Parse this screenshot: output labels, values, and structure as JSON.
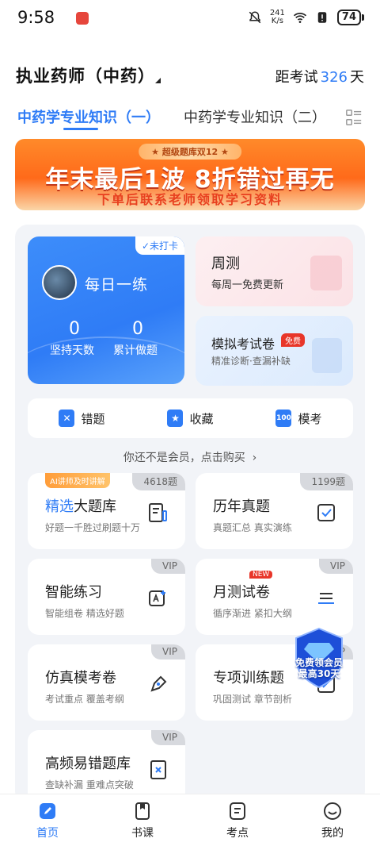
{
  "status_bar": {
    "time": "9:58",
    "net_speed_value": "241",
    "net_speed_unit": "K/s",
    "battery": "74"
  },
  "header": {
    "exam_title": "执业药师（中药）",
    "countdown_prefix": "距考试",
    "countdown_days": "326",
    "countdown_suffix": "天"
  },
  "tabs": [
    {
      "label": "中药学专业知识（一）",
      "active": true
    },
    {
      "label": "中药学专业知识（二）",
      "active": false
    }
  ],
  "banner": {
    "ribbon": "★ 超级题库双12 ★",
    "main": "年末最后1波 8折错过再无",
    "sub": "下单后联系老师领取学习资料"
  },
  "daily": {
    "checkin_tag": "✓未打卡",
    "title": "每日一练",
    "streak_value": "0",
    "streak_label": "坚持天数",
    "total_value": "0",
    "total_label": "累计做题"
  },
  "weekly": {
    "title": "周测",
    "subtitle": "每周一免费更新"
  },
  "mock_exam": {
    "title": "模拟考试卷",
    "badge": "免费",
    "subtitle": "精准诊断·查漏补缺"
  },
  "quick_actions": [
    {
      "label": "错题",
      "icon": "x-icon",
      "glyph": "✕"
    },
    {
      "label": "收藏",
      "icon": "star-bookmark-icon",
      "glyph": "★"
    },
    {
      "label": "模考",
      "icon": "hundred-icon",
      "glyph": "100"
    }
  ],
  "member_tip": "你还不是会员，点击购买",
  "cards": {
    "question_bank": {
      "ai_badge": "AI讲师及时讲解",
      "title_hl": "精选",
      "title_rest": "大题库",
      "subtitle": "好题一千胜过刷题十万",
      "tag": "4618题"
    },
    "past_exams": {
      "title": "历年真题",
      "subtitle": "真题汇总 真实演练",
      "tag": "1199题"
    },
    "smart_practice": {
      "title": "智能练习",
      "subtitle": "智能组卷 精选好题",
      "tag": "VIP"
    },
    "monthly_test": {
      "title": "月测试卷",
      "subtitle": "循序渐进 紧扣大纲",
      "tag": "VIP",
      "new_badge": "NEW"
    },
    "simulated_exam": {
      "title": "仿真模考卷",
      "subtitle": "考试重点 覆盖考纲",
      "tag": "VIP"
    },
    "topic_training": {
      "title": "专项训练题",
      "subtitle": "巩固测试 章节剖析",
      "tag": "VIP"
    },
    "frequent_errors": {
      "title": "高频易错题库",
      "subtitle": "查缺补漏 重难点突破",
      "tag": "VIP"
    }
  },
  "promo": {
    "line1": "免费领会员",
    "line2": "最高30天"
  },
  "bottom_nav": [
    {
      "label": "首页",
      "active": true
    },
    {
      "label": "书课",
      "active": false
    },
    {
      "label": "考点",
      "active": false
    },
    {
      "label": "我的",
      "active": false
    }
  ],
  "colors": {
    "accent": "#2f7cf6",
    "banner_orange": "#ff6a1a",
    "free_red": "#e8362a"
  }
}
